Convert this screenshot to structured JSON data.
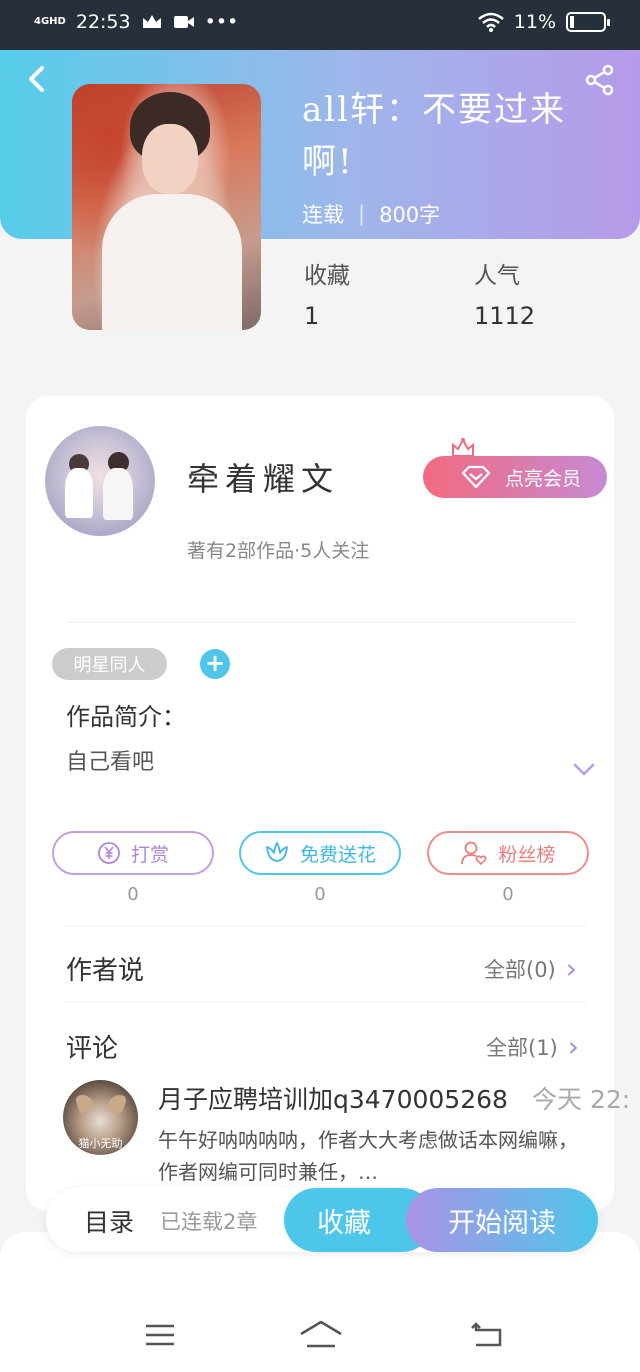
{
  "status_bar": {
    "network": "4GHD",
    "time": "22:53",
    "battery": "11%"
  },
  "book": {
    "title": "all轩：不要过来啊!",
    "status": "连载",
    "word_count": "800字",
    "favorites_label": "收藏",
    "favorites_value": "1",
    "popularity_label": "人气",
    "popularity_value": "1112"
  },
  "author": {
    "name": "牵着耀文",
    "info": "著有2部作品·5人关注",
    "vip_label": "点亮会员"
  },
  "tag": {
    "label": "明星同人",
    "add_symbol": "+"
  },
  "intro": {
    "label": "作品简介：",
    "text": "自己看吧"
  },
  "actions": [
    {
      "label": "打赏",
      "count": "0"
    },
    {
      "label": "免费送花",
      "count": "0"
    },
    {
      "label": "粉丝榜",
      "count": "0"
    }
  ],
  "author_says": {
    "title": "作者说",
    "link": "全部(0)"
  },
  "comments": {
    "title": "评论",
    "link": "全部(1)",
    "items": [
      {
        "user": "月子应聘培训加q3470005268",
        "time": "今天 22:",
        "avatar_caption": "猫小无助",
        "text": "午午好呐呐呐呐，作者大大考虑做话本网编嘛，作者网编可同时兼任，…"
      }
    ]
  },
  "bottom": {
    "toc_label": "目录",
    "toc_count": "已连载2章",
    "favorite_button": "收藏",
    "read_button": "开始阅读"
  },
  "colors": {
    "accent_blue": "#4ec6ea",
    "accent_purple": "#b79ae9",
    "vip_pink": "#f26a7f"
  }
}
